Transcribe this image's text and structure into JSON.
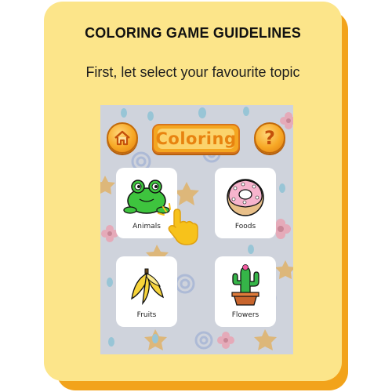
{
  "heading": "COLORING GAME GUIDELINES",
  "subtitle": "First, let select your favourite topic",
  "game": {
    "banner_title": "Coloring",
    "home_icon": "home-icon",
    "help_glyph": "?",
    "topics": [
      {
        "label": "Animals",
        "icon": "frog-icon"
      },
      {
        "label": "Foods",
        "icon": "donut-icon"
      },
      {
        "label": "Fruits",
        "icon": "banana-icon"
      },
      {
        "label": "Flowers",
        "icon": "cactus-icon"
      }
    ]
  },
  "colors": {
    "card_bg": "#fce58a",
    "card_shadow": "#f2a31b",
    "button_orange": "#f7a825",
    "pattern_bg": "#cfd3dc"
  }
}
